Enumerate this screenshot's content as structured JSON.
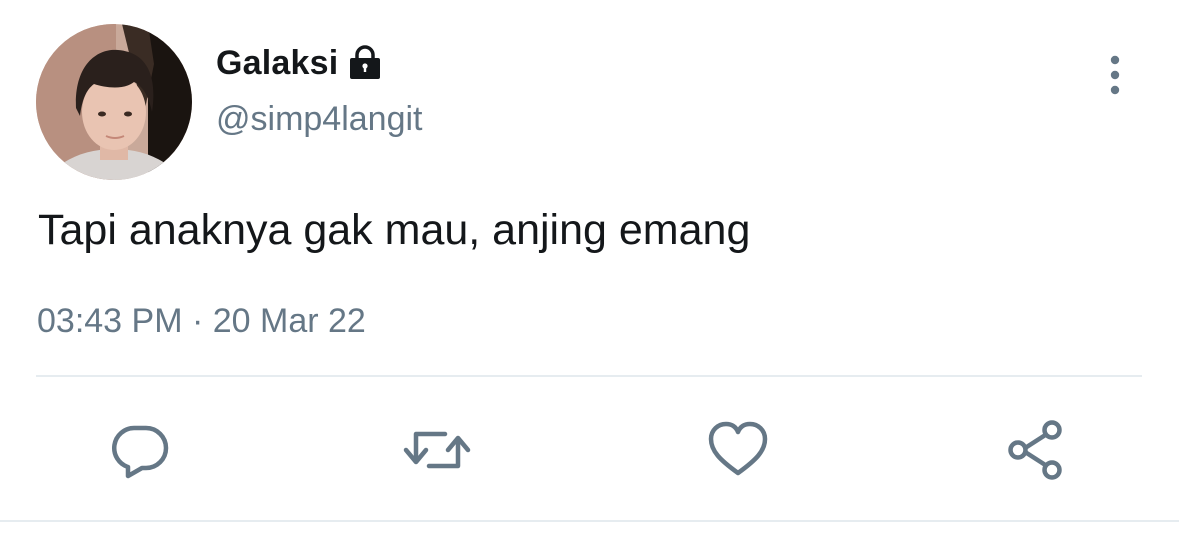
{
  "tweet": {
    "display_name": "Galaksi",
    "handle": "@simp4langit",
    "protected": true,
    "text": "Tapi anaknya gak mau, anjing emang",
    "timestamp": "03:43 PM · 20 Mar 22"
  },
  "icons": {
    "lock": "lock-icon",
    "more": "more-vertical-icon",
    "reply": "reply-icon",
    "retweet": "retweet-icon",
    "like": "heart-icon",
    "share": "share-icon"
  },
  "colors": {
    "text_primary": "#14171a",
    "text_secondary": "#657786",
    "icon": "#657786",
    "divider": "#e6ecf0"
  }
}
